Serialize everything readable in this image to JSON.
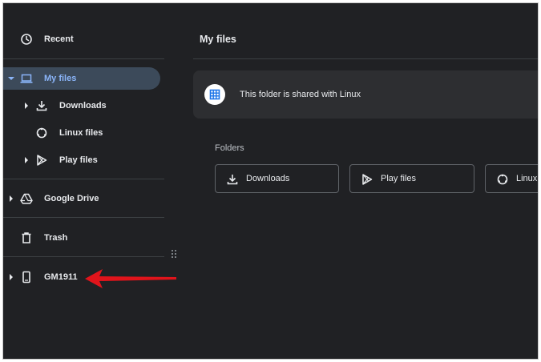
{
  "sidebar": {
    "items": [
      {
        "label": "Recent",
        "icon": "clock-icon"
      },
      {
        "label": "My files",
        "icon": "laptop-icon",
        "selected": true,
        "expanded": true
      },
      {
        "label": "Downloads",
        "icon": "download-icon"
      },
      {
        "label": "Linux files",
        "icon": "linux-icon"
      },
      {
        "label": "Play files",
        "icon": "play-store-icon"
      },
      {
        "label": "Google Drive",
        "icon": "google-drive-icon"
      },
      {
        "label": "Trash",
        "icon": "trash-icon"
      },
      {
        "label": "GM1911",
        "icon": "phone-icon"
      }
    ]
  },
  "main": {
    "title": "My files",
    "banner": {
      "text": "This folder is shared with Linux",
      "icon": "shared-grid-icon"
    },
    "folders_label": "Folders",
    "folders": [
      {
        "label": "Downloads",
        "icon": "download-icon"
      },
      {
        "label": "Play files",
        "icon": "play-store-icon"
      },
      {
        "label": "Linux files",
        "icon": "linux-icon"
      }
    ]
  },
  "colors": {
    "background": "#202124",
    "selected": "#3c4a5a",
    "accent": "#8ab4f8",
    "arrow": "#e0141b"
  }
}
